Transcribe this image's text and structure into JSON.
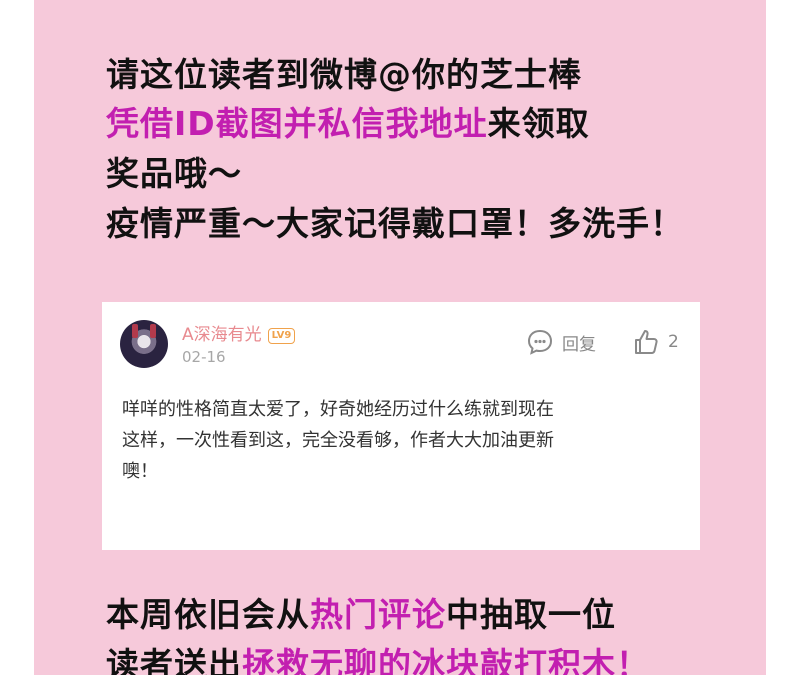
{
  "intro": {
    "line1": "请这位读者到微博@你的芝士棒",
    "line2_highlight": "凭借ID截图并私信我地址",
    "line2_rest": "来领取",
    "line3": "奖品哦～",
    "line4": "疫情严重～大家记得戴口罩！多洗手！"
  },
  "comment_card": {
    "username": "A深海有光",
    "level_badge": "LV9",
    "date": "02-16",
    "reply_label": "回复",
    "like_count": "2",
    "text_lines": [
      "咩咩的性格简直太爱了，好奇她经历过什么练就到现在",
      "这样，一次性看到这，完全没看够，作者大大加油更新",
      "噢！"
    ],
    "icons": [
      "avatar",
      "level-badge-icon",
      "comment-bubble-icon",
      "thumbs-up-icon"
    ]
  },
  "bottom": {
    "line1_prefix": "本周依旧会从",
    "line1_highlight": "热门评论",
    "line1_suffix": "中抽取一位",
    "line2_prefix": "读者送出",
    "line2_highlight": "拯救无聊的冰块敲打积木！"
  },
  "colors": {
    "background": "#f6c9da",
    "highlight": "#c21fb0",
    "username": "#e88a8f",
    "badge": "#f0a24b"
  }
}
